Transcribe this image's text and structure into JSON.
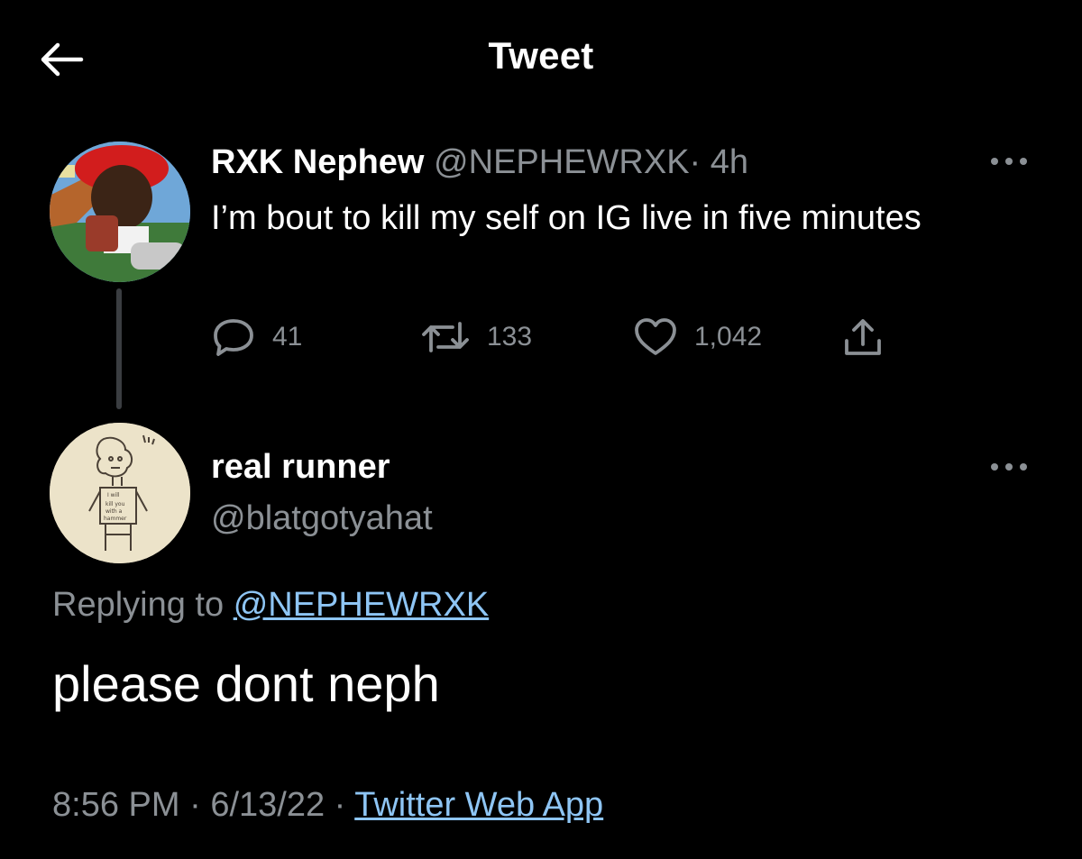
{
  "header": {
    "title": "Tweet",
    "back_icon": "arrow-left-icon"
  },
  "parent_tweet": {
    "display_name": "RXK Nephew",
    "handle": "@NEPHEWRXK",
    "separator": "·",
    "time": "4h",
    "text": "I’m bout to kill my self on IG live in five minutes",
    "reply_count": "41",
    "retweet_count": "133",
    "like_count": "1,042",
    "more_icon": "more-horizontal-icon"
  },
  "reply_tweet": {
    "display_name": "real runner",
    "handle": "@blatgotyahat",
    "replying_label": "Replying to",
    "replying_to": "@NEPHEWRXK",
    "text": "please dont neph",
    "time": "8:56 PM",
    "separator": "·",
    "date": "6/13/22",
    "source": "Twitter Web App",
    "more_icon": "more-horizontal-icon"
  },
  "colors": {
    "background": "#000000",
    "primary_text": "#ffffff",
    "secondary_text": "#8b9095",
    "link": "#8ec5f4",
    "thread_line": "#3a3d41"
  }
}
